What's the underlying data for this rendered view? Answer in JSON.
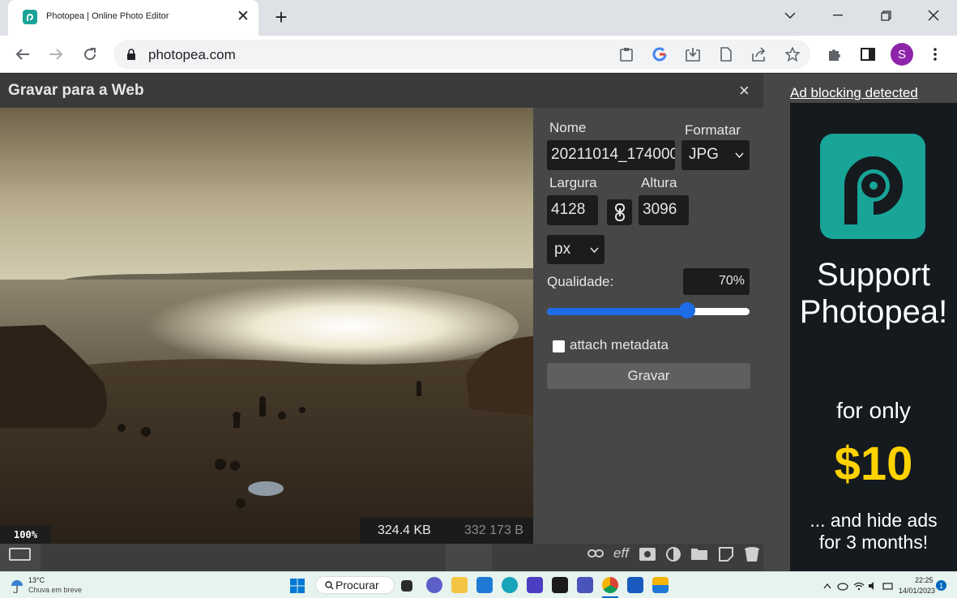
{
  "browser": {
    "tab_title": "Photopea | Online Photo Editor",
    "url": "photopea.com",
    "profile_initial": "S"
  },
  "dialog": {
    "title": "Gravar para a Web",
    "close": "×",
    "zoom": "100%",
    "file_size_kb": "324.4 KB",
    "file_size_bytes": "332 173 B",
    "name_label": "Nome",
    "name_value": "20211014_174000",
    "format_label": "Formatar",
    "format_value": "JPG",
    "width_label": "Largura",
    "width_value": "4128",
    "height_label": "Altura",
    "height_value": "3096",
    "unit_value": "px",
    "quality_label": "Qualidade:",
    "quality_value": "70%",
    "quality_fraction": 0.69,
    "metadata_label": "attach metadata",
    "save_label": "Gravar"
  },
  "ad": {
    "header_link": "Ad blocking detected",
    "line1": "Support",
    "line2": "Photopea!",
    "line3": "for only",
    "price": "$10",
    "line4": "... and hide ads",
    "line5": "for 3 months!"
  },
  "taskbar": {
    "temperature": "13°C",
    "weather": "Chuva em breve",
    "search": "Procurar",
    "time": "22:25",
    "date": "14/01/2023",
    "notifications": "1"
  },
  "colors": {
    "accent_blue": "#1e6be6",
    "photopea_teal": "#18a497",
    "price_yellow": "#ffd200"
  }
}
